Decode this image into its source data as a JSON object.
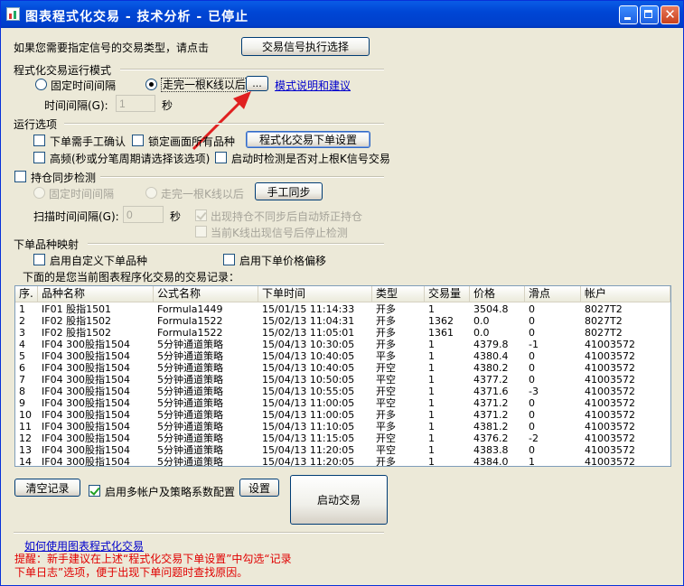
{
  "window": {
    "title": "图表程式化交易 - 技术分析 - 已停止",
    "close_glyph": "✕"
  },
  "signal": {
    "prompt": "如果您需要指定信号的交易类型，请点击",
    "button": "交易信号执行选择"
  },
  "mode": {
    "group_label": "程式化交易运行模式",
    "fixed_label": "固定时间间隔",
    "kline_label": "走完一根K线以后",
    "dots_button": "...",
    "help_link": "模式说明和建议",
    "interval_label": "时间间隔(G):",
    "interval_value": "1",
    "interval_unit": "秒",
    "selected": "kline"
  },
  "options": {
    "group_label": "运行选项",
    "manual_confirm": "下单需手工确认",
    "lock_all": "锁定画面所有品种",
    "order_settings_button": "程式化交易下单设置",
    "high_freq": "高频(秒或分笔周期请选择该选项)",
    "startup_check": "启动时检测是否对上根K信号交易"
  },
  "sync": {
    "group_label": "持仓同步检测",
    "fixed_label": "固定时间间隔",
    "kline_label": "走完一根K线以后",
    "manual_sync_button": "手工同步",
    "scan_label": "扫描时间间隔(G):",
    "scan_value": "0",
    "scan_unit": "秒",
    "auto_fix": "出现持仓不同步后自动矫正持仓",
    "stop_detect": "当前K线出现信号后停止检测"
  },
  "mapping": {
    "group_label": "下单品种映射",
    "custom_symbol": "启用自定义下单品种",
    "price_offset": "启用下单价格偏移"
  },
  "records": {
    "caption": "下面的是您当前图表程序化交易的交易记录：",
    "columns": [
      "序.",
      "品种名称",
      "公式名称",
      "下单时间",
      "类型",
      "交易量",
      "价格",
      "滑点",
      "帐户"
    ],
    "rows": [
      [
        "1",
        "IF01 股指1501",
        "Formula1449",
        "15/01/15 11:14:33",
        "开多",
        "1",
        "3504.8",
        "0",
        "8027T2"
      ],
      [
        "2",
        "IF02 股指1502",
        "Formula1522",
        "15/02/13 11:04:31",
        "开多",
        "1362",
        "0.0",
        "0",
        "8027T2"
      ],
      [
        "3",
        "IF02 股指1502",
        "Formula1522",
        "15/02/13 11:05:01",
        "开多",
        "1361",
        "0.0",
        "0",
        "8027T2"
      ],
      [
        "4",
        "IF04 300股指1504",
        "5分钟通道策略",
        "15/04/13 10:30:05",
        "开多",
        "1",
        "4379.8",
        "-1",
        "41003572"
      ],
      [
        "5",
        "IF04 300股指1504",
        "5分钟通道策略",
        "15/04/13 10:40:05",
        "平多",
        "1",
        "4380.4",
        "0",
        "41003572"
      ],
      [
        "6",
        "IF04 300股指1504",
        "5分钟通道策略",
        "15/04/13 10:40:05",
        "开空",
        "1",
        "4380.2",
        "0",
        "41003572"
      ],
      [
        "7",
        "IF04 300股指1504",
        "5分钟通道策略",
        "15/04/13 10:50:05",
        "平空",
        "1",
        "4377.2",
        "0",
        "41003572"
      ],
      [
        "8",
        "IF04 300股指1504",
        "5分钟通道策略",
        "15/04/13 10:55:05",
        "开空",
        "1",
        "4371.6",
        "-3",
        "41003572"
      ],
      [
        "9",
        "IF04 300股指1504",
        "5分钟通道策略",
        "15/04/13 11:00:05",
        "平空",
        "1",
        "4371.2",
        "0",
        "41003572"
      ],
      [
        "10",
        "IF04 300股指1504",
        "5分钟通道策略",
        "15/04/13 11:00:05",
        "开多",
        "1",
        "4371.2",
        "0",
        "41003572"
      ],
      [
        "11",
        "IF04 300股指1504",
        "5分钟通道策略",
        "15/04/13 11:10:05",
        "平多",
        "1",
        "4381.2",
        "0",
        "41003572"
      ],
      [
        "12",
        "IF04 300股指1504",
        "5分钟通道策略",
        "15/04/13 11:15:05",
        "开空",
        "1",
        "4376.2",
        "-2",
        "41003572"
      ],
      [
        "13",
        "IF04 300股指1504",
        "5分钟通道策略",
        "15/04/13 11:20:05",
        "平空",
        "1",
        "4383.8",
        "0",
        "41003572"
      ],
      [
        "14",
        "IF04 300股指1504",
        "5分钟通道策略",
        "15/04/13 11:20:05",
        "开多",
        "1",
        "4384.0",
        "1",
        "41003572"
      ]
    ]
  },
  "footer": {
    "clear_button": "清空记录",
    "multi_account": "启用多帐户及策略系数配置",
    "settings_button": "设置",
    "start_button": "启动交易",
    "help_link": "如何使用图表程式化交易",
    "tip_line1": "提醒：新手建议在上述“程式化交易下单设置”中勾选“记录",
    "tip_line2": "下单日志”选项，便于出现下单问题时查找原因。"
  },
  "colors": {
    "titlebar": "#0046d5",
    "tip": "#e00000",
    "arrow": "#e02020",
    "link": "#0000cc"
  }
}
